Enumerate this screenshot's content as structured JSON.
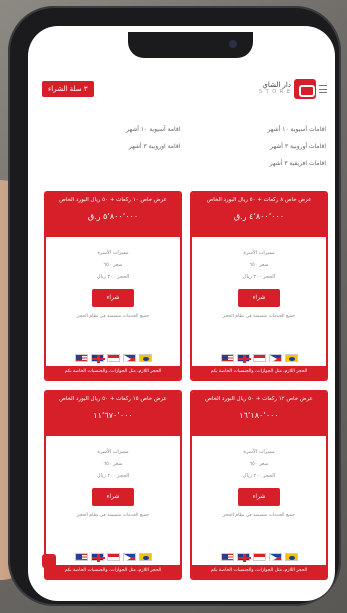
{
  "header": {
    "cart_button": "٣ سلة الشراء",
    "brand_name": "دار الشاي",
    "brand_sub": "S T O R E",
    "menu_icon": "hamburger-icon"
  },
  "info": {
    "rows": [
      {
        "right": "اقامات أسيوية ١٠ أشهر",
        "left": "اقامة آسيوية ١٠ أشهر"
      },
      {
        "right": "اقامات أوروبية ٣ أشهر",
        "left": "اقامة اوروبية ٣ أشهر"
      },
      {
        "right": "اقامات افريقية ٣ أشهر",
        "left": ""
      }
    ]
  },
  "cards": [
    {
      "title": "عرض خاص ١٠ ركعات + ٥٠ ريال البورد الخاص",
      "price": "٥٬٨٠٠٬٠٠٠ ر.ق",
      "lines": [
        "مميزات الأسرة",
        "سعر ٦٥٠",
        "الحجز ٢٠٠ ريال"
      ],
      "buy": "شراء",
      "note": "جميع الخدمات متضمنة في نظام الحجز",
      "flags": [
        "us",
        "uk",
        "id",
        "ph",
        "br"
      ],
      "footer": "الحجز اللازم، مثل الجوازات، والجنسيات الخاصة بكم"
    },
    {
      "title": "عرض خاص ٨ ركعات + ٥٠ ريال البورد الخاص",
      "price": "٤٬٨٠٠٬٠٠٠ ر.ق",
      "lines": [
        "مميزات الأسرة",
        "سعر ٦٥٠",
        "الحجز ٢٠٠ ريال"
      ],
      "buy": "شراء",
      "note": "جميع الخدمات متضمنة في نظام الحجز",
      "flags": [
        "us",
        "uk",
        "id",
        "ph",
        "br"
      ],
      "footer": "الحجز اللازم، مثل الجوازات، والجنسيات الخاصة بكم"
    },
    {
      "title": "عرض خاص ١٥ ركعات + ٥٠ ريال البورد الخاص",
      "price": "١١٬٦٧٠٬٠٠٠",
      "lines": [
        "مميزات الأسرة",
        "سعر ٦٥٠",
        "الحجز ٢٠٠ ريال"
      ],
      "buy": "شراء",
      "note": "جميع الخدمات متضمنة في نظام الحجز",
      "flags": [
        "us",
        "uk",
        "id",
        "ph",
        "br"
      ],
      "footer": "الحجز اللازم، مثل الجوازات، والجنسيات الخاصة بكم"
    },
    {
      "title": "عرض خاص ١٢ ركعات + ٥٠ ريال البورد الخاص",
      "price": "١٦٬١٨٠٬٠٠٠",
      "lines": [
        "مميزات الأسرة",
        "سعر ٦٥٠",
        "الحجز ٢٠٠ ريال"
      ],
      "buy": "شراء",
      "note": "جميع الخدمات متضمنة في نظام الحجز",
      "flags": [
        "us",
        "uk",
        "id",
        "ph",
        "br"
      ],
      "footer": "الحجز اللازم، مثل الجوازات، والجنسيات الخاصة بكم"
    }
  ],
  "colors": {
    "accent": "#d71f2a",
    "background": "#ffffff"
  }
}
